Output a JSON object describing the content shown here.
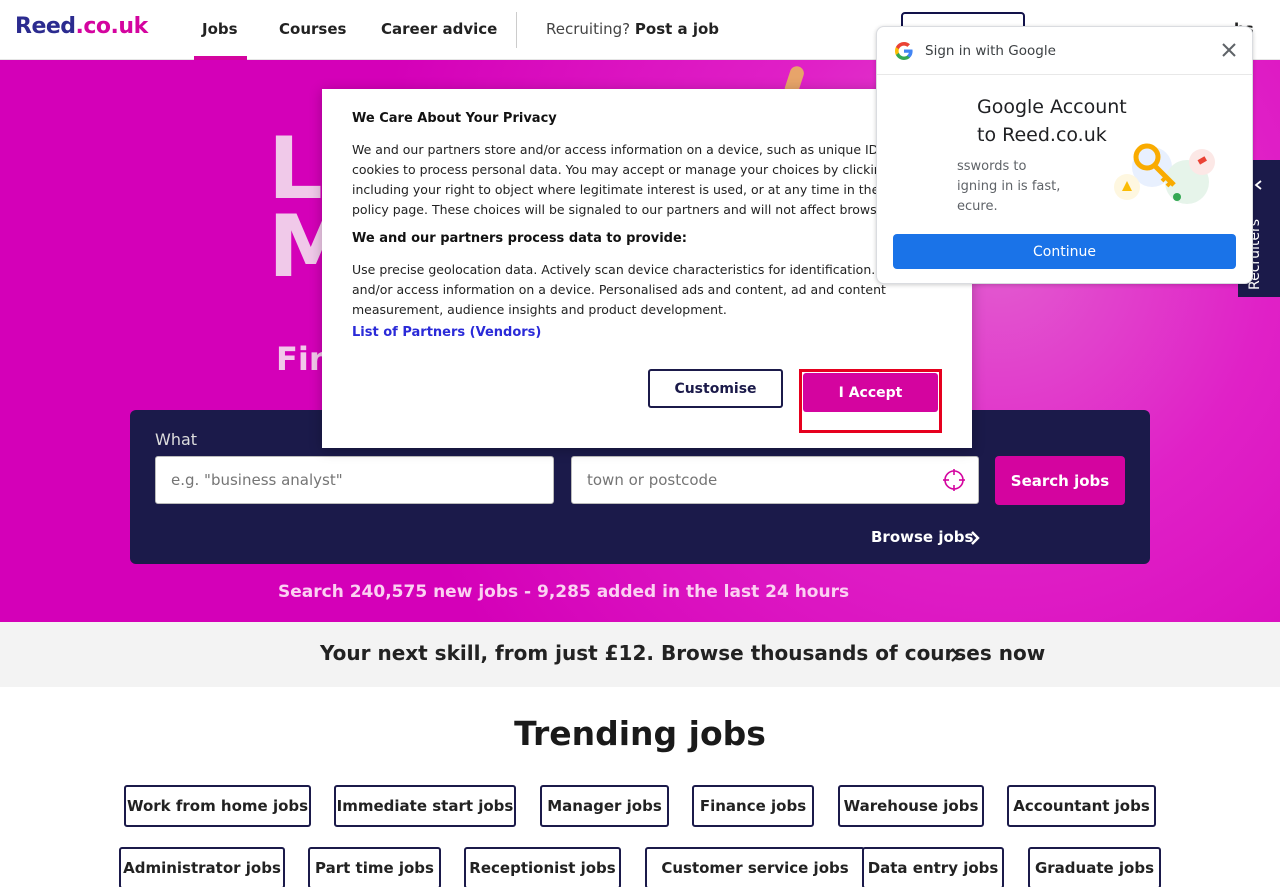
{
  "header": {
    "logo": "Reed",
    "logo_tld": ".co.uk",
    "nav": [
      "Jobs",
      "Courses",
      "Career advice"
    ],
    "recruiting_prefix": "Recruiting?",
    "recruiting_link": "Post a job",
    "right_text": "bs"
  },
  "hero": {
    "big_text": "L\nM",
    "sub_text": "Fin",
    "what_label": "What",
    "what_placeholder": "e.g. \"business analyst\"",
    "where_placeholder": "town or postcode",
    "search_button": "Search jobs",
    "browse_link": "Browse jobs",
    "stats": "Search 240,575 new jobs - 9,285 added in the last 24 hours"
  },
  "courses_banner": "Your next skill, from just £12. Browse thousands of courses now",
  "trending": {
    "title": "Trending jobs",
    "row1": [
      "Work from home jobs",
      "Immediate start jobs",
      "Manager jobs",
      "Finance jobs",
      "Warehouse jobs",
      "Accountant jobs"
    ],
    "row2": [
      "Administrator jobs",
      "Part time jobs",
      "Receptionist jobs",
      "Customer service jobs",
      "Data entry jobs",
      "Graduate jobs"
    ]
  },
  "privacy": {
    "title": "We Care About Your Privacy",
    "p1": "We and our partners store and/or access information on a device, such as unique IDs in cookies to process personal data. You may accept or manage your choices by clicking below, including your right to object where legitimate interest is used, or at any time in the privacy policy page. These choices will be signaled to our partners and will not affect browsing data.",
    "h2": "We and our partners process data to provide:",
    "p2": "Use precise geolocation data. Actively scan device characteristics for identification. Store and/or access information on a device. Personalised ads and content, ad and content measurement, audience insights and product development.",
    "partners_link": "List of Partners (Vendors)",
    "customise": "Customise",
    "accept": "I Accept"
  },
  "google_signin": {
    "title": "Sign in with Google",
    "heading_line1": "Google Account",
    "heading_line2": "to Reed.co.uk",
    "body": "sswords to\nigning in is fast,\necure.",
    "continue": "Continue"
  },
  "recruiters_tab": "Recruiters",
  "colors": {
    "brand_pink": "#d4049f",
    "navy": "#1b1a4a",
    "google_blue": "#1a73e8",
    "highlight_red": "#e6001e"
  }
}
